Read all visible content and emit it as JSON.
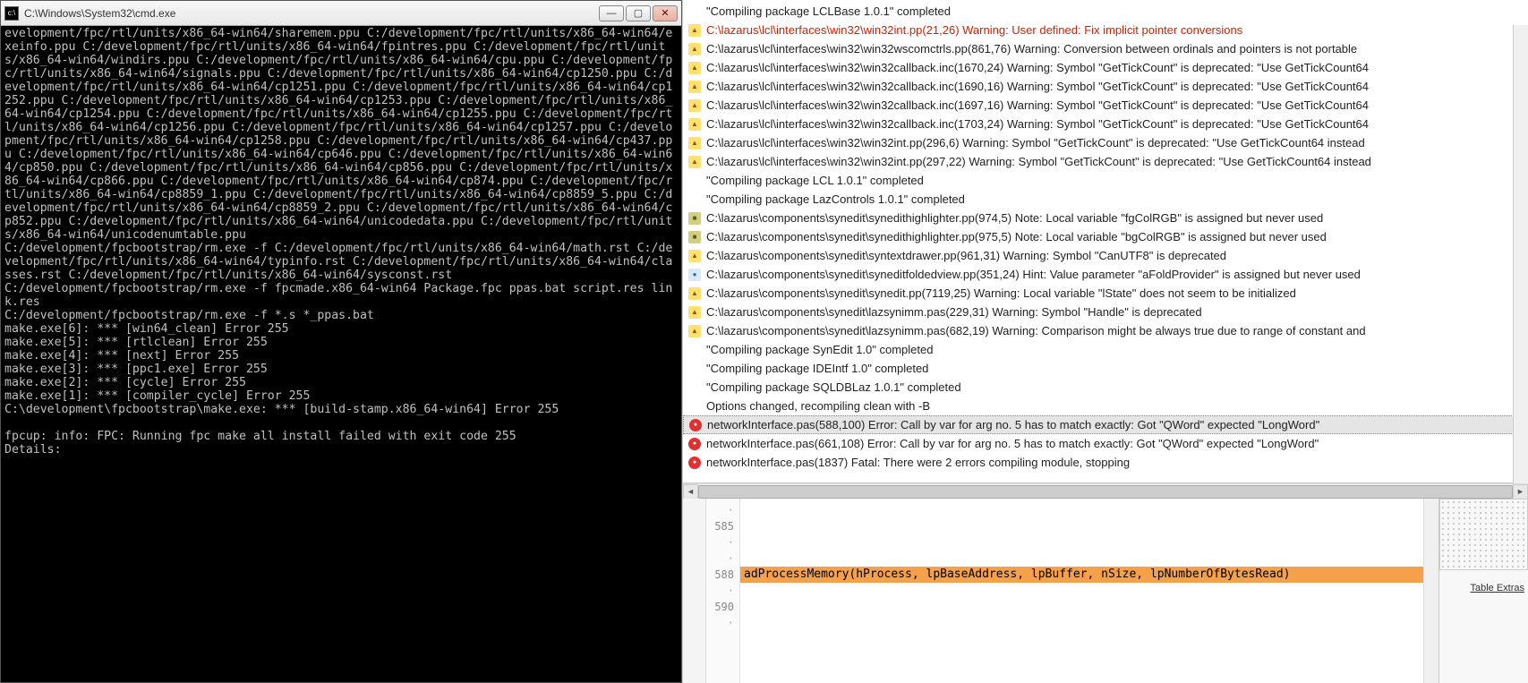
{
  "cmd": {
    "title": "C:\\Windows\\System32\\cmd.exe",
    "content": "evelopment/fpc/rtl/units/x86_64-win64/sharemem.ppu C:/development/fpc/rtl/units/x86_64-win64/exeinfo.ppu C:/development/fpc/rtl/units/x86_64-win64/fpintres.ppu C:/development/fpc/rtl/units/x86_64-win64/windirs.ppu C:/development/fpc/rtl/units/x86_64-win64/cpu.ppu C:/development/fpc/rtl/units/x86_64-win64/signals.ppu C:/development/fpc/rtl/units/x86_64-win64/cp1250.ppu C:/development/fpc/rtl/units/x86_64-win64/cp1251.ppu C:/development/fpc/rtl/units/x86_64-win64/cp1252.ppu C:/development/fpc/rtl/units/x86_64-win64/cp1253.ppu C:/development/fpc/rtl/units/x86_64-win64/cp1254.ppu C:/development/fpc/rtl/units/x86_64-win64/cp1255.ppu C:/development/fpc/rtl/units/x86_64-win64/cp1256.ppu C:/development/fpc/rtl/units/x86_64-win64/cp1257.ppu C:/development/fpc/rtl/units/x86_64-win64/cp1258.ppu C:/development/fpc/rtl/units/x86_64-win64/cp437.ppu C:/development/fpc/rtl/units/x86_64-win64/cp646.ppu C:/development/fpc/rtl/units/x86_64-win64/cp850.ppu C:/development/fpc/rtl/units/x86_64-win64/cp856.ppu C:/development/fpc/rtl/units/x86_64-win64/cp866.ppu C:/development/fpc/rtl/units/x86_64-win64/cp874.ppu C:/development/fpc/rtl/units/x86_64-win64/cp8859_1.ppu C:/development/fpc/rtl/units/x86_64-win64/cp8859_5.ppu C:/development/fpc/rtl/units/x86_64-win64/cp8859_2.ppu C:/development/fpc/rtl/units/x86_64-win64/cp852.ppu C:/development/fpc/rtl/units/x86_64-win64/unicodedata.ppu C:/development/fpc/rtl/units/x86_64-win64/unicodenumtable.ppu\nC:/development/fpcbootstrap/rm.exe -f C:/development/fpc/rtl/units/x86_64-win64/math.rst C:/development/fpc/rtl/units/x86_64-win64/typinfo.rst C:/development/fpc/rtl/units/x86_64-win64/classes.rst C:/development/fpc/rtl/units/x86_64-win64/sysconst.rst\nC:/development/fpcbootstrap/rm.exe -f fpcmade.x86_64-win64 Package.fpc ppas.bat script.res link.res\nC:/development/fpcbootstrap/rm.exe -f *.s *_ppas.bat\nmake.exe[6]: *** [win64_clean] Error 255\nmake.exe[5]: *** [rtlclean] Error 255\nmake.exe[4]: *** [next] Error 255\nmake.exe[3]: *** [ppc1.exe] Error 255\nmake.exe[2]: *** [cycle] Error 255\nmake.exe[1]: *** [compiler_cycle] Error 255\nC:\\development\\fpcbootstrap\\make.exe: *** [build-stamp.x86_64-win64] Error 255\n\nfpcup: info: FPC: Running fpc make all install failed with exit code 255\nDetails:"
  },
  "messages": [
    {
      "icon": "none",
      "text": "\"Compiling package LCLBase 1.0.1\" completed"
    },
    {
      "icon": "warn",
      "red": true,
      "text": "C:\\lazarus\\lcl\\interfaces\\win32\\win32int.pp(21,26) Warning: User defined: Fix implicit pointer conversions"
    },
    {
      "icon": "warn",
      "text": "C:\\lazarus\\lcl\\interfaces\\win32\\win32wscomctrls.pp(861,76) Warning: Conversion between ordinals and pointers is not portable"
    },
    {
      "icon": "warn",
      "text": "C:\\lazarus\\lcl\\interfaces\\win32\\win32callback.inc(1670,24) Warning: Symbol \"GetTickCount\" is deprecated: \"Use GetTickCount64"
    },
    {
      "icon": "warn",
      "text": "C:\\lazarus\\lcl\\interfaces\\win32\\win32callback.inc(1690,16) Warning: Symbol \"GetTickCount\" is deprecated: \"Use GetTickCount64"
    },
    {
      "icon": "warn",
      "text": "C:\\lazarus\\lcl\\interfaces\\win32\\win32callback.inc(1697,16) Warning: Symbol \"GetTickCount\" is deprecated: \"Use GetTickCount64"
    },
    {
      "icon": "warn",
      "text": "C:\\lazarus\\lcl\\interfaces\\win32\\win32callback.inc(1703,24) Warning: Symbol \"GetTickCount\" is deprecated: \"Use GetTickCount64"
    },
    {
      "icon": "warn",
      "text": "C:\\lazarus\\lcl\\interfaces\\win32\\win32int.pp(296,6) Warning: Symbol \"GetTickCount\" is deprecated: \"Use GetTickCount64 instead"
    },
    {
      "icon": "warn",
      "text": "C:\\lazarus\\lcl\\interfaces\\win32\\win32int.pp(297,22) Warning: Symbol \"GetTickCount\" is deprecated: \"Use GetTickCount64 instead"
    },
    {
      "icon": "none",
      "text": "\"Compiling package LCL 1.0.1\" completed"
    },
    {
      "icon": "none",
      "text": "\"Compiling package LazControls 1.0.1\" completed"
    },
    {
      "icon": "note",
      "text": "C:\\lazarus\\components\\synedit\\synedithighlighter.pp(974,5) Note: Local variable \"fgColRGB\" is assigned but never used"
    },
    {
      "icon": "note",
      "text": "C:\\lazarus\\components\\synedit\\synedithighlighter.pp(975,5) Note: Local variable \"bgColRGB\" is assigned but never used"
    },
    {
      "icon": "warn",
      "text": "C:\\lazarus\\components\\synedit\\syntextdrawer.pp(961,31) Warning: Symbol \"CanUTF8\" is deprecated"
    },
    {
      "icon": "hint",
      "text": "C:\\lazarus\\components\\synedit\\syneditfoldedview.pp(351,24) Hint: Value parameter \"aFoldProvider\" is assigned but never used"
    },
    {
      "icon": "warn",
      "text": "C:\\lazarus\\components\\synedit\\synedit.pp(7119,25) Warning: Local variable \"lState\" does not seem to be initialized"
    },
    {
      "icon": "warn",
      "text": "C:\\lazarus\\components\\synedit\\lazsynimm.pas(229,31) Warning: Symbol \"Handle\" is deprecated"
    },
    {
      "icon": "warn",
      "text": "C:\\lazarus\\components\\synedit\\lazsynimm.pas(682,19) Warning: Comparison might be always true due to range of constant and"
    },
    {
      "icon": "none",
      "text": "\"Compiling package SynEdit 1.0\" completed"
    },
    {
      "icon": "none",
      "text": "\"Compiling package IDEIntf 1.0\" completed"
    },
    {
      "icon": "none",
      "text": "\"Compiling package SQLDBLaz 1.0.1\" completed"
    },
    {
      "icon": "none",
      "text": "Options changed, recompiling clean with -B"
    },
    {
      "icon": "error",
      "selected": true,
      "text": "networkInterface.pas(588,100) Error: Call by var for arg no. 5 has to match exactly: Got \"QWord\" expected \"LongWord\""
    },
    {
      "icon": "error",
      "text": "networkInterface.pas(661,108) Error: Call by var for arg no. 5 has to match exactly: Got \"QWord\" expected \"LongWord\""
    },
    {
      "icon": "error",
      "text": "networkInterface.pas(1837) Fatal: There were 2 errors compiling module, stopping"
    }
  ],
  "code": {
    "gutter": [
      "",
      "585",
      "",
      "",
      "588",
      "",
      "590",
      ""
    ],
    "lines": [
      {
        "text": "",
        "hl": false
      },
      {
        "text": "",
        "hl": false
      },
      {
        "text": "",
        "hl": false
      },
      {
        "text": "",
        "hl": false
      },
      {
        "text": "adProcessMemory(hProcess, lpBaseAddress, lpBuffer, nSize, lpNumberOfBytesRead)",
        "hl": true
      },
      {
        "text": "",
        "hl": false
      },
      {
        "text": "",
        "hl": false
      },
      {
        "text": "",
        "hl": false
      }
    ]
  },
  "sidepanel": {
    "tab": "Table Extras"
  }
}
